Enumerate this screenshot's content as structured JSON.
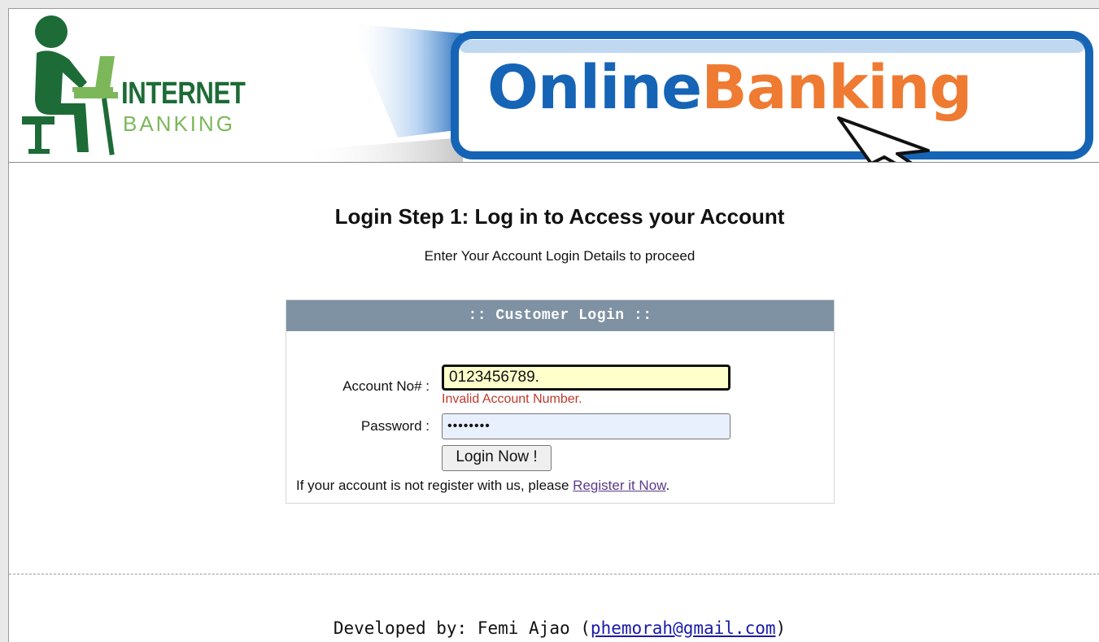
{
  "header": {
    "logo_line1": "INTERNET",
    "logo_line2": "BANKING",
    "banner_word1": "Online",
    "banner_word2": "Banking"
  },
  "main": {
    "title": "Login Step 1: Log in to Access your Account",
    "subtitle": "Enter Your Account Login Details to proceed"
  },
  "login_form": {
    "header": ":: Customer Login ::",
    "account_label": "Account No# :",
    "account_value": "0123456789.",
    "account_error": "Invalid Account Number.",
    "password_label": "Password  :",
    "password_value": "••••••••",
    "submit_label": "Login Now !",
    "register_prefix": "If your account is not register with us, please ",
    "register_link": "Register it Now",
    "register_suffix": "."
  },
  "footer": {
    "developed_prefix": "Developed by: Femi Ajao (",
    "developer_email": "phemorah@gmail.com",
    "developed_suffix": ")"
  },
  "colors": {
    "panel_header": "#7f92a4",
    "error": "#c0392b",
    "account_field_bg": "#ffffcc",
    "password_field_bg": "#e8f0fe",
    "logo_green_dark": "#1d6b36",
    "logo_green_light": "#7cb85a",
    "banner_blue": "#1564b6",
    "banner_orange": "#ef7a31"
  }
}
